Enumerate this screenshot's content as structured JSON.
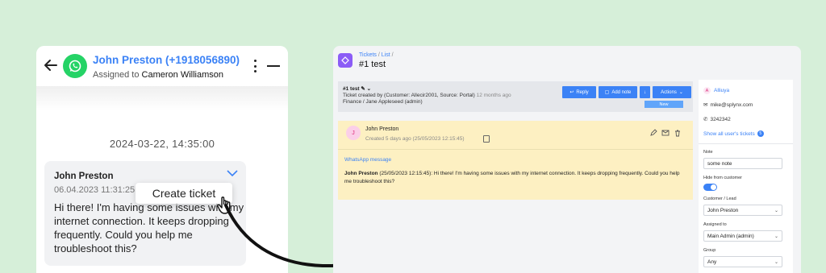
{
  "chat": {
    "contact_name": "John Preston (+1918056890)",
    "assigned_prefix": "Assigned to",
    "assigned_to": "Cameron Williamson",
    "date_divider": "2024-03-22, 14:35:00",
    "message": {
      "sender": "John Preston",
      "time": "06.04.2023 11:31:25",
      "text": "Hi there! I'm having some issues with my internet connection. It keeps dropping frequently. Could you help me troubleshoot this?"
    },
    "tooltip": "Create ticket"
  },
  "ticket": {
    "breadcrumb": {
      "tickets": "Tickets",
      "sep1": "/",
      "list": "List",
      "sep2": "/"
    },
    "title": "#1 test",
    "header": {
      "id_label": "#1 test",
      "created_line": "Ticket created by (Customer: Allecir2001, Source: Portal)",
      "created_ago": "12 months ago",
      "assignee_line": "Finance / Jane Appleseed (admin)"
    },
    "buttons": {
      "reply": "Reply",
      "add_note": "Add note",
      "actions": "Actions"
    },
    "status_badge": "New",
    "message": {
      "avatar_letter": "J",
      "author": "John Preston",
      "created": "Created 5 days ago (25/05/2023 12:15:45)",
      "source": "WhatsApp message",
      "body_bold": "John Preston",
      "body": " (25/05/2023 12:15:45): Hi there! I'm having some issues with my internet connection. It keeps dropping frequently. Could you help me troubleshoot this?"
    },
    "sidebar": {
      "avatar_letter": "A",
      "user": "Alliuya",
      "email": "mike@splynx.com",
      "phone": "3242342",
      "all_tickets_link": "Show all user's tickets",
      "tickets_count": "5",
      "note_label": "Note",
      "note_value": "some note",
      "hide_label": "Hide from customer",
      "customer_label": "Customer / Lead",
      "customer_value": "John Preston",
      "assigned_label": "Assigned to",
      "assigned_value": "Main Admin (admin)",
      "group_label": "Group",
      "group_value": "Any"
    }
  },
  "colors": {
    "background": "#d6efd9",
    "accent": "#3b82f6",
    "whatsapp": "#25d366",
    "message_bg": "#fdf0c2"
  }
}
